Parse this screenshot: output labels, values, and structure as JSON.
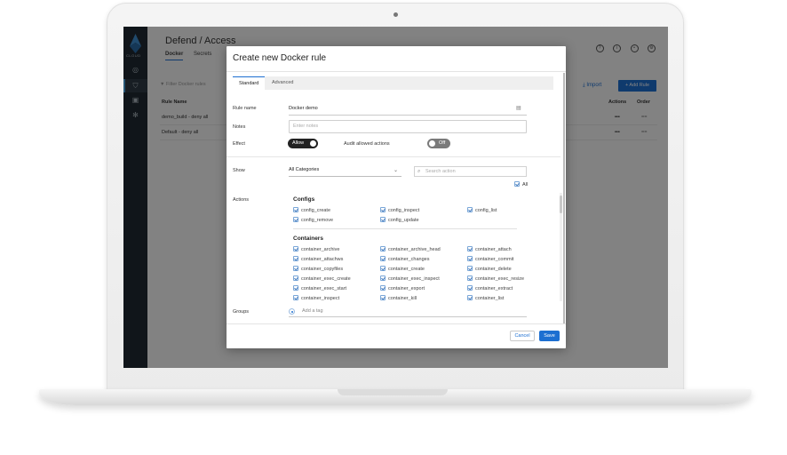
{
  "app": {
    "logo_text": "CLOUD",
    "page_title": "Defend / Access",
    "tabs": [
      {
        "label": "Docker"
      },
      {
        "label": "Secrets"
      }
    ],
    "top_icons": [
      "help-icon",
      "info-icon",
      "user-icon",
      "settings-icon"
    ],
    "filter_placeholder": "Filter Docker rules",
    "import_label": "Import",
    "add_rule_label": "Add Rule",
    "table": {
      "headers": {
        "name": "Rule Name",
        "actions": "Actions",
        "order": "Order"
      },
      "rows": [
        {
          "name": "demo_build - deny all",
          "actions": "•••",
          "order": "=="
        },
        {
          "name": "Default - deny all",
          "actions": "•••",
          "order": "=="
        }
      ]
    }
  },
  "modal": {
    "title": "Create new Docker rule",
    "tabs": {
      "standard": "Standard",
      "advanced": "Advanced"
    },
    "rule_name": {
      "label": "Rule name",
      "value": "Docker demo"
    },
    "notes": {
      "label": "Notes",
      "placeholder": "Enter notes"
    },
    "effect": {
      "label": "Effect",
      "toggle_label": "Allow",
      "audit_label": "Audit allowed actions",
      "audit_toggle_label": "Off"
    },
    "show": {
      "label": "Show",
      "value": "All Categories",
      "search_placeholder": "Search action",
      "all_label": "All"
    },
    "actions_label": "Actions",
    "groups": [
      {
        "title": "Configs",
        "items": [
          "config_create",
          "config_inspect",
          "config_list",
          "config_remove",
          "config_update"
        ]
      },
      {
        "title": "Containers",
        "items": [
          "container_archive",
          "container_archive_head",
          "container_attach",
          "container_attachws",
          "container_changes",
          "container_commit",
          "container_copyfiles",
          "container_create",
          "container_delete",
          "container_exec_create",
          "container_exec_inspect",
          "container_exec_resize",
          "container_exec_start",
          "container_export",
          "container_extract",
          "container_inspect",
          "container_kill",
          "container_list"
        ]
      }
    ],
    "groups_field": {
      "label": "Groups",
      "placeholder": "Add a tag"
    },
    "cancel_label": "Cancel",
    "save_label": "Save"
  }
}
